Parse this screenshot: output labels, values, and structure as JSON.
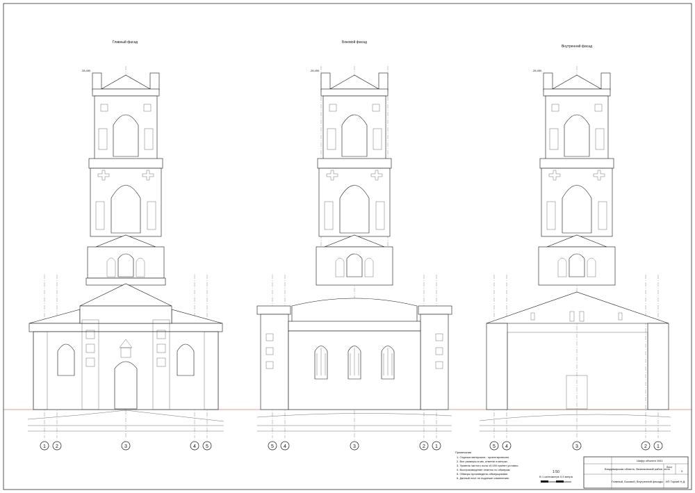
{
  "views": [
    {
      "title": "Главный фасад",
      "axes": [
        "1",
        "2",
        "3",
        "4",
        "5"
      ],
      "top_mark": "28,450"
    },
    {
      "title": "Боковой фасад",
      "axes": [
        "5",
        "4",
        "3",
        "2",
        "1"
      ],
      "top_mark": "28,450"
    },
    {
      "title": "Внутренний фасад",
      "axes": [
        "5",
        "4",
        "3",
        "2",
        "1"
      ],
      "top_mark": "28,450"
    }
  ],
  "notes": {
    "heading": "Примечания",
    "items": [
      "1. Отделка материала - ориентировочно.",
      "2. Все размеры в мм, отметки в метрах.",
      "3. Уровень чистого пола ±0,000 принят условно.",
      "4. Воспроизведение отметок по обмерам.",
      "5. Обмеры произведены обмерщиками.",
      "6. Данный лист не подлежит изменению."
    ]
  },
  "scale": {
    "label": "1:50",
    "note": "В 1 сантиметре 0,5 метра"
  },
  "title_block": {
    "object": "Шифр объекта 1941",
    "location": "Владимирская область, Вязниковский район, село",
    "stage": "Лист",
    "sheet_title": "Главный, Боковой, Внутренний фасады",
    "sheet_no": "3",
    "org": "ИП Торкий Н.Д."
  },
  "colors": {
    "ink": "#111111",
    "ground_line": "#c0392b"
  }
}
